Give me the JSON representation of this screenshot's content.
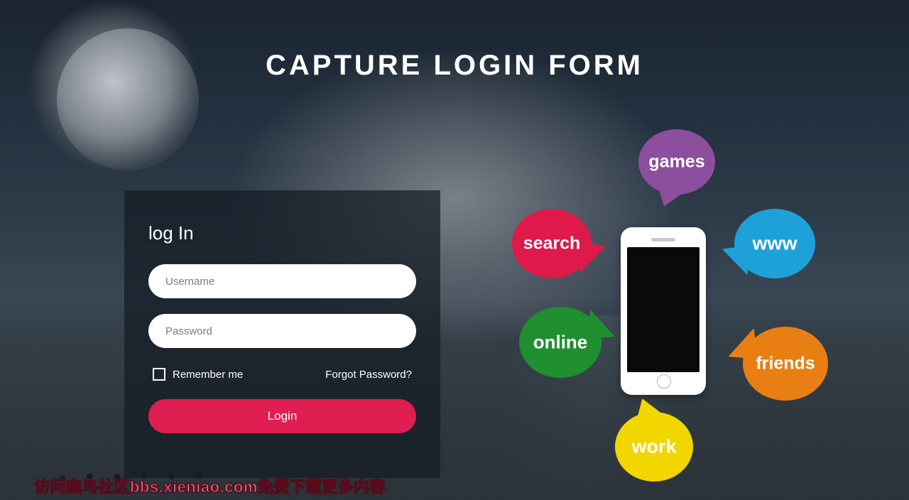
{
  "header": {
    "title": "CAPTURE LOGIN FORM"
  },
  "form": {
    "heading": "log In",
    "username_placeholder": "Username",
    "password_placeholder": "Password",
    "remember_label": "Remember me",
    "forgot_label": "Forgot Password?",
    "submit_label": "Login"
  },
  "bubbles": {
    "games": "games",
    "search": "search",
    "www": "www",
    "online": "online",
    "friends": "friends",
    "work": "work"
  },
  "footer": {
    "watermark": "访问幽鸟社区bbs.xieniao.com免费下载更多内容"
  }
}
